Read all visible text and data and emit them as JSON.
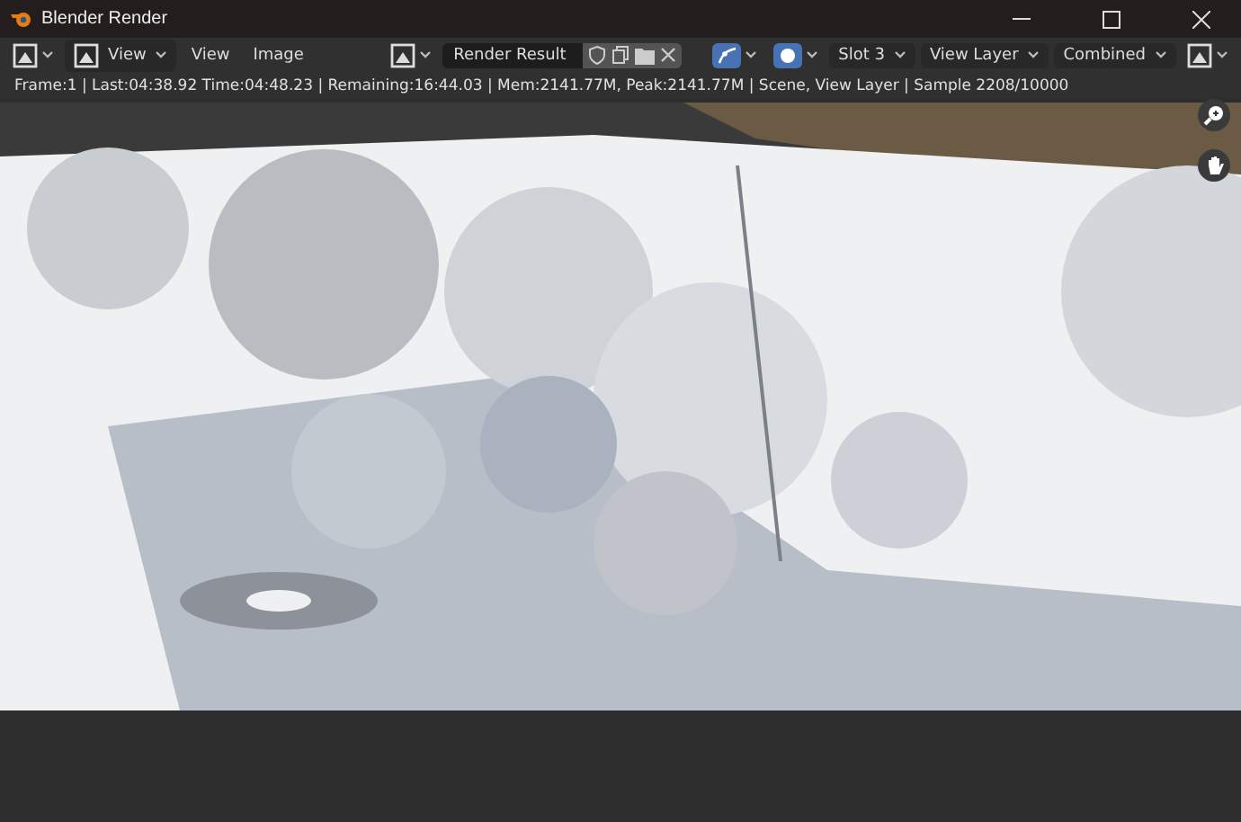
{
  "window": {
    "title": "Blender Render"
  },
  "toolbar": {
    "view_dropdown": "View",
    "menus": [
      "View",
      "Image"
    ],
    "image_name": "Render Result",
    "toggles": [
      {
        "on": true
      },
      {
        "on": true
      }
    ],
    "dropdowns": [
      "Slot 3",
      "View Layer",
      "Combined"
    ]
  },
  "info_line": "Frame:1 | Last:04:38.92 Time:04:48.23 | Remaining:16:44.03 | Mem:2141.77M, Peak:2141.77M | Scene, View Layer | Sample 2208/10000"
}
